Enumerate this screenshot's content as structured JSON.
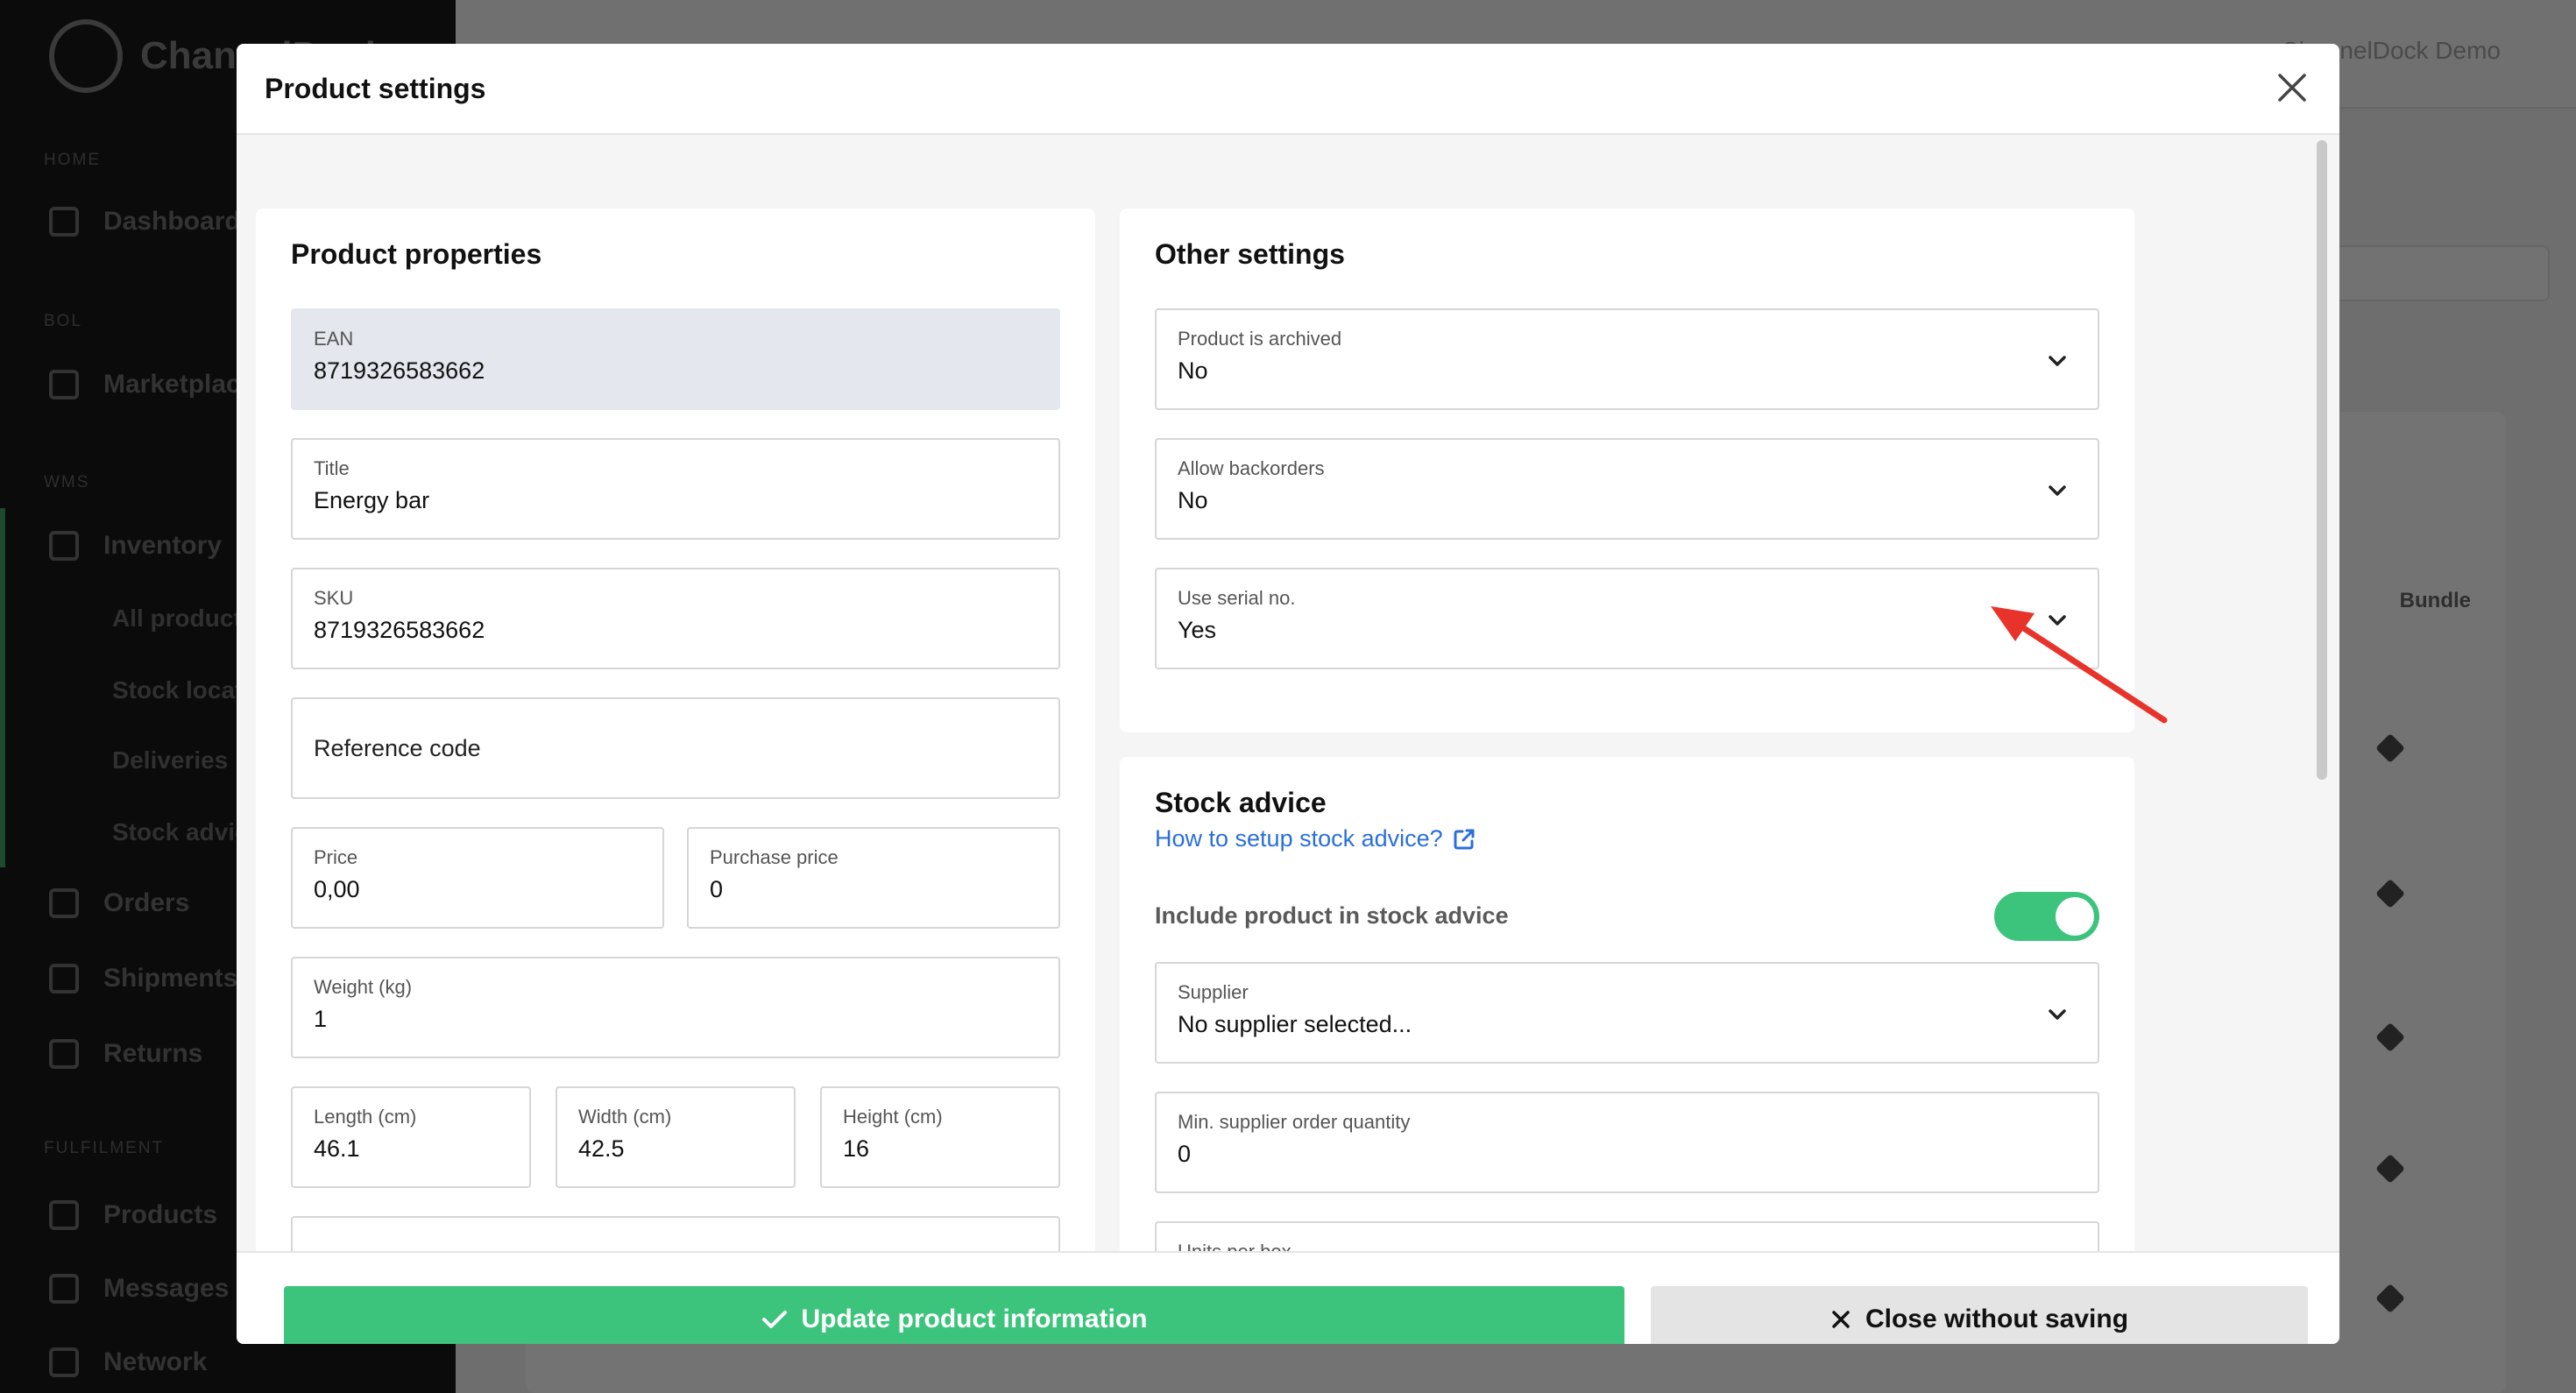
{
  "background": {
    "brand": "ChannelDock",
    "user": "ChannelDock Demo",
    "sections": [
      "Home",
      "Bol",
      "WMS",
      "Fulfilment"
    ],
    "nav": [
      "Dashboard",
      "Marketplace",
      "Inventory",
      "Orders",
      "Shipments",
      "Returns",
      "Products",
      "Messages",
      "Network"
    ],
    "inventory_sub": [
      "All products",
      "Stock locations",
      "Deliveries",
      "Stock advice"
    ],
    "column": "Bundle"
  },
  "modal": {
    "title": "Product settings",
    "properties": {
      "title": "Product properties",
      "ean": {
        "label": "EAN",
        "value": "8719326583662"
      },
      "product_title": {
        "label": "Title",
        "value": "Energy bar"
      },
      "sku": {
        "label": "SKU",
        "value": "8719326583662"
      },
      "reference_code": {
        "placeholder": "Reference code"
      },
      "price": {
        "label": "Price",
        "value": "0,00"
      },
      "purchase_price": {
        "label": "Purchase price",
        "value": "0"
      },
      "weight": {
        "label": "Weight (kg)",
        "value": "1"
      },
      "length": {
        "label": "Length (cm)",
        "value": "46.1"
      },
      "width": {
        "label": "Width (cm)",
        "value": "42.5"
      },
      "height": {
        "label": "Height (cm)",
        "value": "16"
      }
    },
    "other": {
      "title": "Other settings",
      "archived": {
        "label": "Product is archived",
        "value": "No"
      },
      "backorders": {
        "label": "Allow backorders",
        "value": "No"
      },
      "serial": {
        "label": "Use serial no.",
        "value": "Yes"
      }
    },
    "stock_advice": {
      "title": "Stock advice",
      "help_link": "How to setup stock advice?",
      "include_label": "Include product in stock advice",
      "include_enabled": true,
      "supplier": {
        "label": "Supplier",
        "value": "No supplier selected..."
      },
      "min_order": {
        "label": "Min. supplier order quantity",
        "value": "0"
      },
      "units_per_box": {
        "label": "Units per box"
      }
    },
    "footer": {
      "update_label": "Update product information",
      "close_label": "Close without saving"
    }
  },
  "colors": {
    "accent_green": "#3cc47c",
    "link_blue": "#2a6fdb",
    "arrow_red": "#e8332a"
  }
}
